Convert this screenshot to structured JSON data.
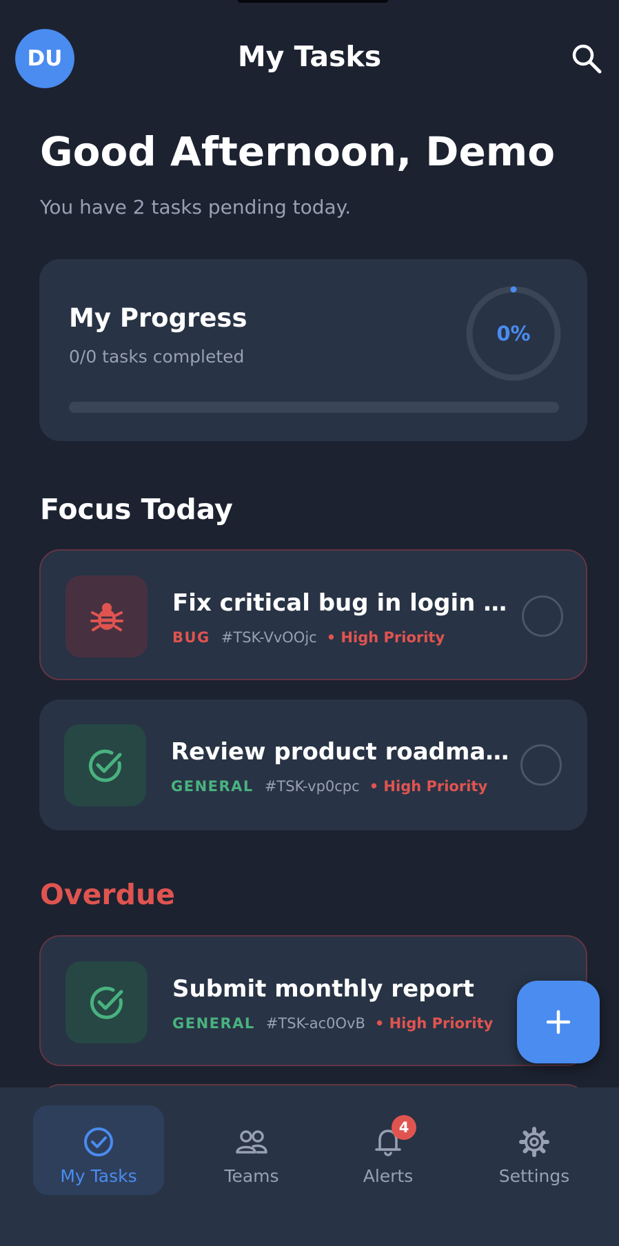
{
  "header": {
    "avatar_initials": "DU",
    "title": "My Tasks",
    "search_icon": "search-icon"
  },
  "greeting": {
    "title": "Good Afternoon, Demo",
    "subtitle": "You have 2 tasks pending today."
  },
  "progress": {
    "title": "My Progress",
    "summary": "0/0 tasks completed",
    "percent_label": "0%",
    "fraction": 0
  },
  "sections": {
    "focus_title": "Focus Today",
    "overdue_title": "Overdue"
  },
  "focus_tasks": [
    {
      "title": "Fix critical bug in login fl...",
      "category": "BUG",
      "id": "#TSK-VvOOjc",
      "priority": "• High Priority",
      "icon": "bug-icon"
    },
    {
      "title": "Review product roadmap ...",
      "category": "GENERAL",
      "id": "#TSK-vp0cpc",
      "priority": "• High Priority",
      "icon": "check-circle-icon"
    }
  ],
  "overdue_tasks": [
    {
      "title": "Submit monthly report",
      "category": "GENERAL",
      "id": "#TSK-ac0OvB",
      "priority": "• High Priority",
      "icon": "check-circle-icon"
    }
  ],
  "fab": {
    "icon": "plus-icon"
  },
  "nav": {
    "items": [
      {
        "label": "My Tasks",
        "icon": "tasks-check-icon"
      },
      {
        "label": "Teams",
        "icon": "users-icon"
      },
      {
        "label": "Alerts",
        "icon": "bell-icon",
        "badge": "4"
      },
      {
        "label": "Settings",
        "icon": "gear-icon"
      }
    ]
  },
  "colors": {
    "background": "#1c2230",
    "card": "#283345",
    "accent": "#4a8cf0",
    "danger": "#e05450",
    "success": "#49b27f"
  }
}
